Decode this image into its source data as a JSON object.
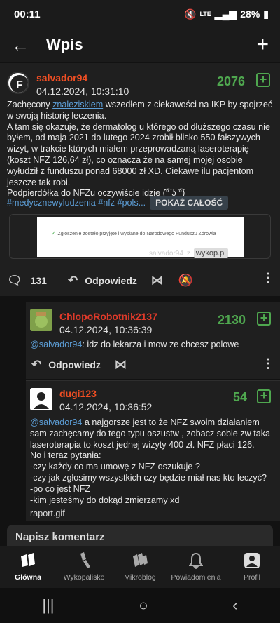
{
  "status": {
    "time": "00:11",
    "battery": "28%",
    "network": "LTE"
  },
  "appbar": {
    "title": "Wpis"
  },
  "post": {
    "author": "salvador94",
    "date": "04.12.2024, 10:31:10",
    "votes": "2076",
    "body": [
      {
        "pre": "Zachęcony ",
        "link": "znaleziskiem",
        "post": " wszedłem z ciekawości na IKP by spojrzeć w swoją historię leczenia."
      },
      "A tam się okazuje, że dermatolog u którego od dłuższego czasu nie byłem, od maja 2021 do lutego 2024 zrobił blisko 550 fałszywych wizyt, w trakcie których miałem przeprowadzaną laseroterapię (koszt NFZ 126,64 zł), co oznacza że na samej mojej osobie wyłudził z funduszu ponad 68000 zł XD. Ciekawe ilu pacjentom jeszcze tak robi.",
      "Podpierdółka do NFZu oczywiście idzie (͡° ͜ʖ ͡°)"
    ],
    "tags": "#medycznewyludzenia #nfz #pols...",
    "show_all": "POKAŻ CAŁOŚĆ",
    "embed_text": "Zgłoszenie zostało przyjęte i wysłane do Narodowego Funduszu Zdrowia",
    "embed_caption_user": "salvador94",
    "embed_caption_z": "z",
    "embed_caption_site": "wykop.pl",
    "comments_count": "131",
    "reply_label": "Odpowiedz"
  },
  "replies": [
    {
      "author": "ChlopoRobotnik2137",
      "date": "04.12.2024, 10:36:39",
      "votes": "2130",
      "mention": "@salvador94",
      "text": ": idz do lekarza i mow ze chcesz polowe",
      "reply_label": "Odpowiedz"
    },
    {
      "author": "dugi123",
      "date": "04.12.2024, 10:36:52",
      "votes": "54",
      "mention": "@salvador94",
      "text": " a najgorsze jest to że NFZ swoim działaniem sam zachęcamy do tego typu oszustw , zobacz sobie zw taka laseroterapia to koszt jednej wizyty 400 zł.  NFZ płaci 126.",
      "lines": [
        "No i teraz pytania:",
        "-czy każdy co ma umowę z NFZ oszukuje ?",
        "-czy jak zgłosimy wszystkich czy będzie miał nas kto leczyć?",
        "-po co jest NFZ",
        "-kim jesteśmy do dokąd zmierzamy xd"
      ],
      "attachment": "raport.gif"
    }
  ],
  "compose": {
    "placeholder": "Napisz komentarz"
  },
  "nav": [
    {
      "label": "Główna",
      "icon": "home-icon"
    },
    {
      "label": "Wykopalisko",
      "icon": "shovel-icon"
    },
    {
      "label": "Mikroblog",
      "icon": "microblog-icon"
    },
    {
      "label": "Powiadomienia",
      "icon": "bell-icon"
    },
    {
      "label": "Profil",
      "icon": "profile-icon"
    }
  ]
}
